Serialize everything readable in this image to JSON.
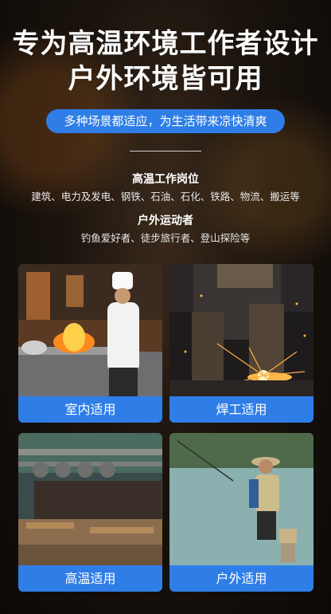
{
  "headline": {
    "line1": "专为高温环境工作者设计",
    "line2": "户外环境皆可用"
  },
  "pill": "多种场景都适应，为生活带来凉快清爽",
  "sections": [
    {
      "title": "高温工作岗位",
      "text": "建筑、电力及发电、钢铁、石油、石化、铁路、物流、搬运等"
    },
    {
      "title": "户外运动者",
      "text": "钓鱼爱好者、徒步旅行者、登山探险等"
    }
  ],
  "cards": [
    {
      "label": "室内适用",
      "image": "kitchen-chef-photo"
    },
    {
      "label": "焊工适用",
      "image": "welder-sparks-photo"
    },
    {
      "label": "高温适用",
      "image": "steel-construction-site-photo"
    },
    {
      "label": "户外适用",
      "image": "fishing-lake-photo"
    }
  ],
  "colors": {
    "accent": "#2f7ee8",
    "background": "#1a130d"
  }
}
